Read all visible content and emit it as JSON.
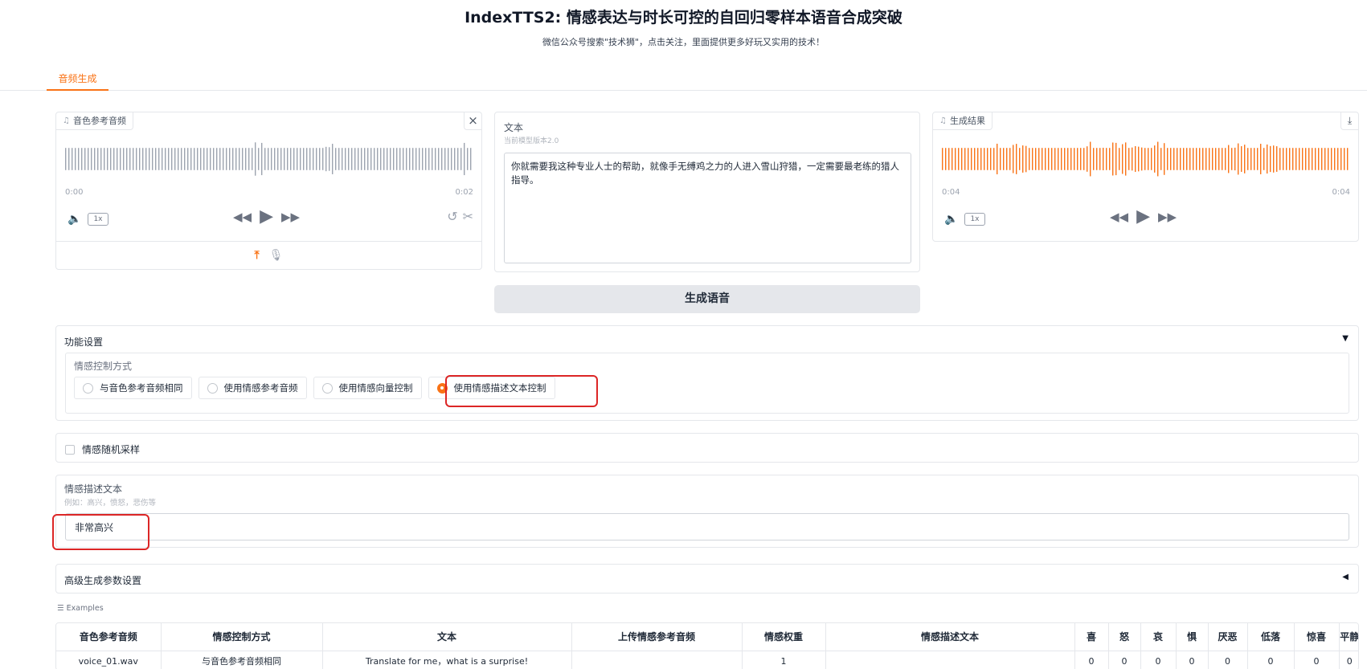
{
  "header": {
    "title": "IndexTTS2: 情感表达与时长可控的自回归零样本语音合成突破",
    "subtitle": "微信公众号搜索\"技术狮\"，点击关注，里面提供更多好玩又实用的技术！"
  },
  "tabs": [
    {
      "label": "音频生成"
    }
  ],
  "ref_audio": {
    "label": "音色参考音频",
    "time_start": "0:00",
    "time_end": "0:02",
    "speed": "1x",
    "wave_color": "#9ca3af"
  },
  "text_panel": {
    "label": "文本",
    "info": "当前模型版本2.0",
    "value": "你就需要我这种专业人士的帮助，就像手无缚鸡之力的人进入雪山狩猎，一定需要最老练的猎人指导。"
  },
  "result_audio": {
    "label": "生成结果",
    "time_start": "0:04",
    "time_end": "0:04",
    "speed": "1x",
    "wave_color": "#f97316"
  },
  "generate_button": {
    "label": "生成语音"
  },
  "function_settings": {
    "title": "功能设置",
    "emotion_control": {
      "label": "情感控制方式",
      "options": [
        "与音色参考音频相同",
        "使用情感参考音频",
        "使用情感向量控制",
        "使用情感描述文本控制"
      ],
      "selected_index": 3
    }
  },
  "random_sampling": {
    "label": "情感随机采样"
  },
  "emotion_text": {
    "label": "情感描述文本",
    "info": "例如：高兴，愤怒，悲伤等",
    "value": "非常高兴"
  },
  "advanced": {
    "title": "高级生成参数设置"
  },
  "examples": {
    "label": "Examples",
    "columns": [
      "音色参考音频",
      "情感控制方式",
      "文本",
      "上传情感参考音频",
      "情感权重",
      "情感描述文本",
      "喜",
      "怒",
      "哀",
      "惧",
      "厌恶",
      "低落",
      "惊喜",
      "平静"
    ],
    "rows": [
      [
        "voice_01.wav",
        "与音色参考音频相同",
        "Translate for me，what is a surprise!",
        "",
        "1",
        "",
        "0",
        "0",
        "0",
        "0",
        "0",
        "0",
        "0",
        "0"
      ]
    ]
  },
  "colors": {
    "accent": "#f97316",
    "highlight": "#dc2626"
  }
}
